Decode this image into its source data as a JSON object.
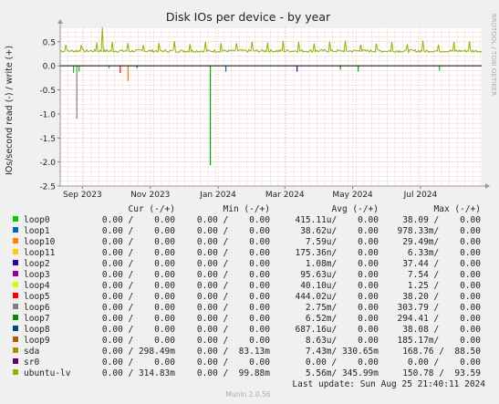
{
  "chart_data": {
    "type": "line",
    "title": "Disk IOs per device - by year",
    "ylabel": "IOs/second read (-) / write (+)",
    "side_label": "RRDTOOL / TOBI OETIKER",
    "ylim": [
      -2.5,
      0.8
    ],
    "y_ticks": [
      0.5,
      0.0,
      -0.5,
      -1.0,
      -1.5,
      -2.0,
      -2.5
    ],
    "y_tick_labels": [
      "0.5",
      "0.0",
      "-0.5",
      "-1.0",
      "-1.5",
      "-2.0",
      "-2.5"
    ],
    "x_range": [
      "2023-08-12",
      "2024-08-25"
    ],
    "x_ticks": [
      {
        "date": "2023-09-01",
        "label": "Sep 2023"
      },
      {
        "date": "2023-11-01",
        "label": "Nov 2023"
      },
      {
        "date": "2024-01-01",
        "label": "Jan 2024"
      },
      {
        "date": "2024-03-01",
        "label": "Mar 2024"
      },
      {
        "date": "2024-05-01",
        "label": "May 2024"
      },
      {
        "date": "2024-07-01",
        "label": "Jul 2024"
      }
    ],
    "grid": true,
    "write_baseline": {
      "name": "ubuntu-lv",
      "mean": 0.31,
      "spike_max": 0.8
    },
    "read_spikes": [
      {
        "date": "2023-08-24",
        "value": -0.15,
        "color": "#00cc00"
      },
      {
        "date": "2023-08-27",
        "value": -1.1,
        "color": "#888888"
      },
      {
        "date": "2023-08-29",
        "value": -0.12,
        "color": "#00cc00"
      },
      {
        "date": "2023-09-25",
        "value": -0.05,
        "color": "#00cc00"
      },
      {
        "date": "2023-10-05",
        "value": -0.15,
        "color": "#ff0000"
      },
      {
        "date": "2023-10-12",
        "value": -0.32,
        "color": "#cc8800"
      },
      {
        "date": "2023-10-20",
        "value": -0.05,
        "color": "#0066b3"
      },
      {
        "date": "2023-12-25",
        "value": -2.07,
        "color": "#00aa00"
      },
      {
        "date": "2024-01-08",
        "value": -0.12,
        "color": "#0066b3"
      },
      {
        "date": "2024-03-12",
        "value": -0.12,
        "color": "#330099"
      },
      {
        "date": "2024-04-20",
        "value": -0.08,
        "color": "#008f00"
      },
      {
        "date": "2024-05-06",
        "value": -0.12,
        "color": "#00aa00"
      },
      {
        "date": "2024-07-18",
        "value": -0.1,
        "color": "#00cc00"
      }
    ],
    "legend_headers": [
      "Cur (-/+)",
      "Min (-/+)",
      "Avg (-/+)",
      "Max (-/+)"
    ],
    "series": [
      {
        "name": "loop0",
        "color": "#00cc00",
        "cur": "0.00 /    0.00",
        "min": "0.00 /    0.00",
        "avg": "415.11u/    0.00",
        "max": "38.09 /    0.00"
      },
      {
        "name": "loop1",
        "color": "#0066b3",
        "cur": "0.00 /    0.00",
        "min": "0.00 /    0.00",
        "avg": "38.62u/    0.00",
        "max": "978.33m/    0.00"
      },
      {
        "name": "loop10",
        "color": "#ff8000",
        "cur": "0.00 /    0.00",
        "min": "0.00 /    0.00",
        "avg": "7.59u/    0.00",
        "max": "29.49m/    0.00"
      },
      {
        "name": "loop11",
        "color": "#ffcc00",
        "cur": "0.00 /    0.00",
        "min": "0.00 /    0.00",
        "avg": "175.36n/    0.00",
        "max": "6.33m/    0.00"
      },
      {
        "name": "loop2",
        "color": "#330099",
        "cur": "0.00 /    0.00",
        "min": "0.00 /    0.00",
        "avg": "1.08m/    0.00",
        "max": "37.44 /    0.00"
      },
      {
        "name": "loop3",
        "color": "#990099",
        "cur": "0.00 /    0.00",
        "min": "0.00 /    0.00",
        "avg": "95.63u/    0.00",
        "max": "7.54 /    0.00"
      },
      {
        "name": "loop4",
        "color": "#ccff00",
        "cur": "0.00 /    0.00",
        "min": "0.00 /    0.00",
        "avg": "40.10u/    0.00",
        "max": "1.25 /    0.00"
      },
      {
        "name": "loop5",
        "color": "#ff0000",
        "cur": "0.00 /    0.00",
        "min": "0.00 /    0.00",
        "avg": "444.02u/    0.00",
        "max": "38.20 /    0.00"
      },
      {
        "name": "loop6",
        "color": "#808080",
        "cur": "0.00 /    0.00",
        "min": "0.00 /    0.00",
        "avg": "2.75m/    0.00",
        "max": "303.79 /    0.00"
      },
      {
        "name": "loop7",
        "color": "#008f00",
        "cur": "0.00 /    0.00",
        "min": "0.00 /    0.00",
        "avg": "6.52m/    0.00",
        "max": "294.41 /    0.00"
      },
      {
        "name": "loop8",
        "color": "#00487d",
        "cur": "0.00 /    0.00",
        "min": "0.00 /    0.00",
        "avg": "687.16u/    0.00",
        "max": "38.08 /    0.00"
      },
      {
        "name": "loop9",
        "color": "#b35a00",
        "cur": "0.00 /    0.00",
        "min": "0.00 /    0.00",
        "avg": "8.63u/    0.00",
        "max": "185.17m/    0.00"
      },
      {
        "name": "sda",
        "color": "#b38f00",
        "cur": "0.00 / 298.49m",
        "min": "0.00 /  83.13m",
        "avg": "7.43m/ 330.65m",
        "max": "168.76 /  88.50"
      },
      {
        "name": "sr0",
        "color": "#6b006b",
        "cur": "0.00 /    0.00",
        "min": "0.00 /    0.00",
        "avg": "0.00 /    0.00",
        "max": "0.00 /    0.00"
      },
      {
        "name": "ubuntu-lv",
        "color": "#8fb300",
        "cur": "0.00 / 314.83m",
        "min": "0.00 /  99.88m",
        "avg": "5.56m/ 345.99m",
        "max": "150.78 /  93.59"
      }
    ],
    "last_update": "Last update: Sun Aug 25 21:40:11 2024",
    "footer": "Munin 2.0.56"
  }
}
